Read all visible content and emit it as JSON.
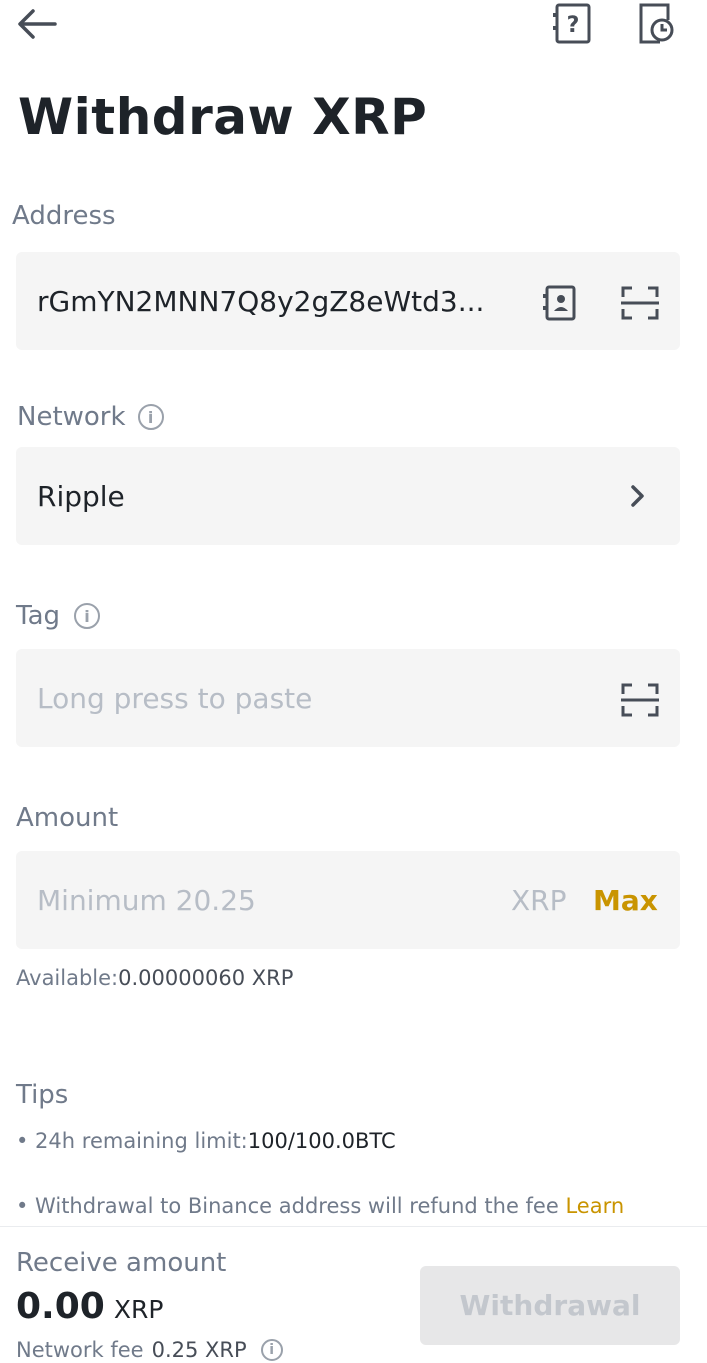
{
  "header": {
    "back_icon": "arrow-left-icon",
    "help_icon": "help-document-icon",
    "history_icon": "history-record-icon"
  },
  "page": {
    "title": "Withdraw XRP"
  },
  "address": {
    "label": "Address",
    "value": "rGmYN2MNN7Q8y2gZ8eWtd3...",
    "address_book_icon": "address-book-icon",
    "scan_icon": "scan-icon"
  },
  "network": {
    "label": "Network",
    "value": "Ripple",
    "info_icon": "info-icon",
    "chevron_icon": "chevron-right-icon"
  },
  "tag": {
    "label": "Tag",
    "placeholder": "Long press to paste",
    "info_icon": "info-icon",
    "scan_icon": "scan-icon"
  },
  "amount": {
    "label": "Amount",
    "placeholder": "Minimum 20.25",
    "unit": "XRP",
    "max_label": "Max",
    "available_label": "Available:",
    "available_value": "0.00000060 XRP"
  },
  "tips": {
    "title": "Tips",
    "limit_label": "• 24h remaining limit:",
    "limit_value": "100/100.0BTC",
    "refund_text": "• Withdrawal to Binance address will refund the fee ",
    "learn_link": "Learn"
  },
  "footer": {
    "receive_label": "Receive amount",
    "receive_value": "0.00",
    "receive_unit": "XRP",
    "fee_label": "Network fee",
    "fee_value": "0.25 XRP",
    "withdraw_button": "Withdrawal"
  },
  "colors": {
    "accent": "#c99400",
    "text_primary": "#1e2329",
    "text_secondary": "#707a8a",
    "field_bg": "#f5f5f5",
    "disabled_button": "#e7e7e8"
  }
}
